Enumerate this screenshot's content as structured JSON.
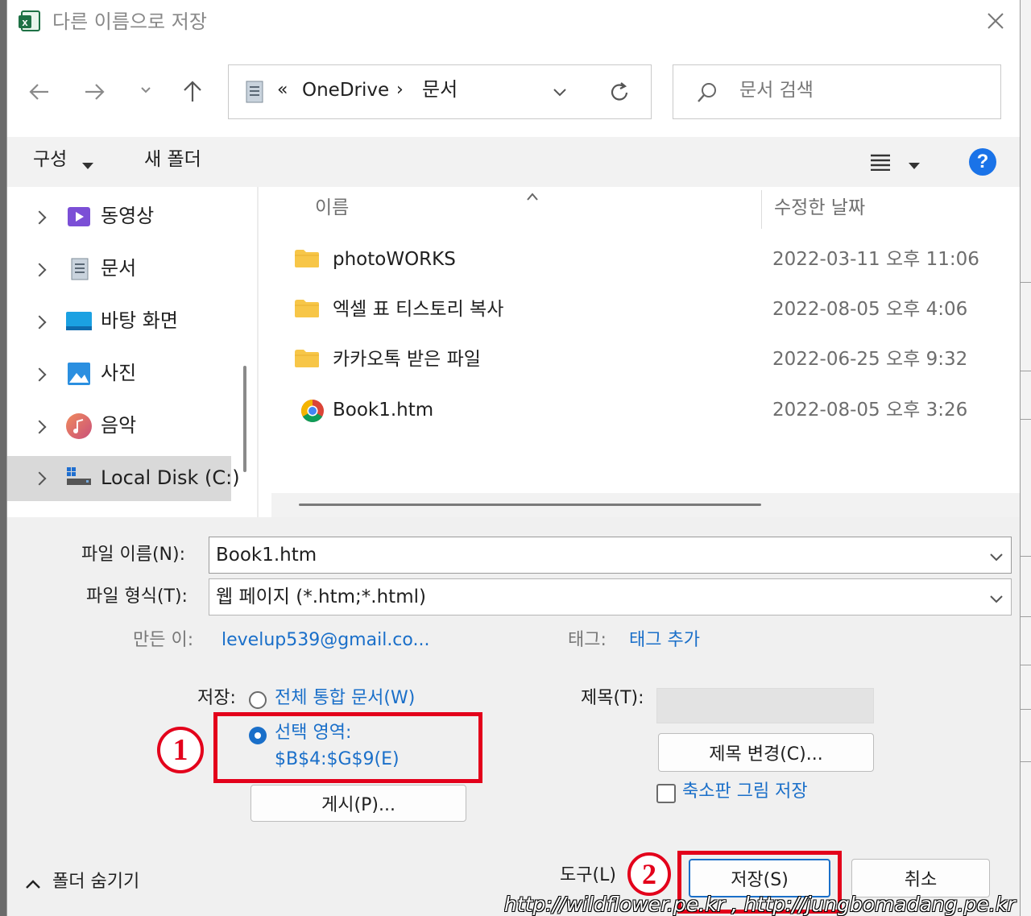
{
  "window": {
    "title": "다른 이름으로 저장"
  },
  "nav": {
    "address_prefix": "«",
    "path": [
      "OneDrive",
      "문서"
    ],
    "search_placeholder": "문서 검색"
  },
  "toolbar": {
    "organize": "구성",
    "new_folder": "새 폴더"
  },
  "sidebar": {
    "items": [
      {
        "label": "동영상",
        "icon": "videos-icon"
      },
      {
        "label": "문서",
        "icon": "documents-icon"
      },
      {
        "label": "바탕 화면",
        "icon": "desktop-icon"
      },
      {
        "label": "사진",
        "icon": "pictures-icon"
      },
      {
        "label": "음악",
        "icon": "music-icon"
      },
      {
        "label": "Local Disk (C:)",
        "icon": "drive-icon",
        "selected": true
      }
    ]
  },
  "file_list": {
    "columns": [
      "이름",
      "수정한 날짜"
    ],
    "rows": [
      {
        "name": "photoWORKS",
        "date": "2022-03-11 오후 11:06",
        "type": "folder"
      },
      {
        "name": "엑셀 표 티스토리 복사",
        "date": "2022-08-05 오후 4:06",
        "type": "folder"
      },
      {
        "name": "카카오톡 받은 파일",
        "date": "2022-06-25 오후 9:32",
        "type": "folder"
      },
      {
        "name": "Book1.htm",
        "date": "2022-08-05 오후 3:26",
        "type": "chrome-html"
      }
    ]
  },
  "form": {
    "filename_label": "파일 이름(N):",
    "filename_value": "Book1.htm",
    "filetype_label": "파일 형식(T):",
    "filetype_value": "웹 페이지 (*.htm;*.html)",
    "author_label": "만든 이:",
    "author_value": "levelup539@gmail.co...",
    "tags_label": "태그:",
    "tags_value": "태그 추가",
    "save_label": "저장:",
    "option_workbook": "전체 통합 문서(W)",
    "option_selection_line1": "선택 영역:",
    "option_selection_line2": "$B$4:$G$9(E)",
    "publish_button": "게시(P)...",
    "title_label": "제목(T):",
    "change_title_button": "제목 변경(C)...",
    "thumbnail_label": "축소판 그림 저장"
  },
  "footer": {
    "hide_folders": "폴더 숨기기",
    "tools": "도구(L)",
    "save_button": "저장(S)",
    "cancel_button": "취소"
  },
  "annotations": {
    "marker1": "①",
    "marker2": "②"
  },
  "watermark": "http://wildflower.pe.kr , http://jungbomadang.pe.kr",
  "colors": {
    "accent": "#1a6fc9",
    "highlight": "#e3001b",
    "help": "#1a73e8"
  }
}
